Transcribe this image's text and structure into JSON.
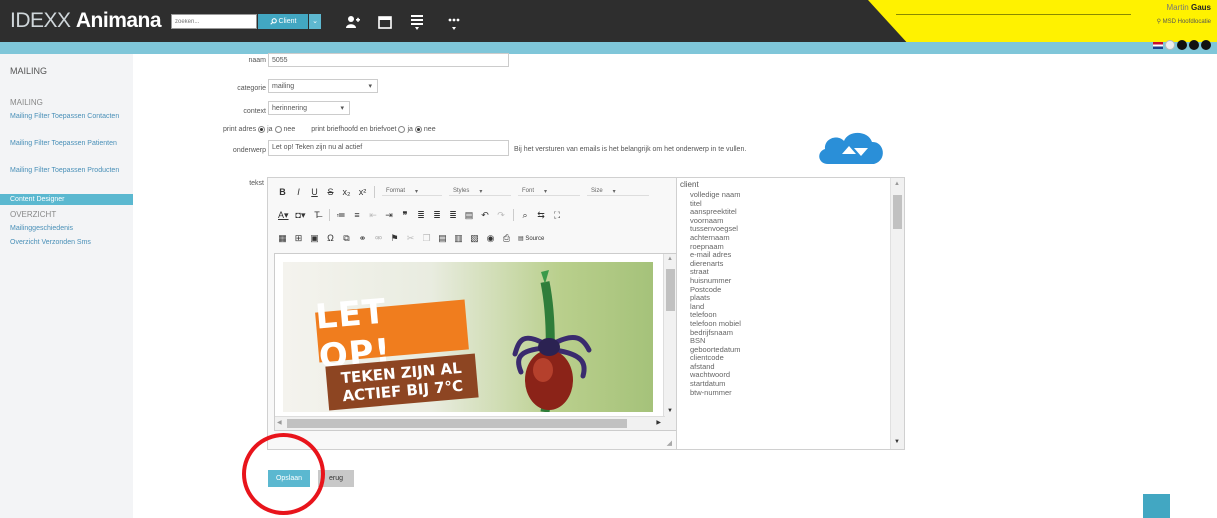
{
  "header": {
    "logo_light": "IDEXX",
    "logo_bold": "Animana",
    "search_placeholder": "zoeken...",
    "client_button": "Client",
    "user_first": "Martin",
    "user_last": "Gaus",
    "location": "MSD Hoofdlocatie"
  },
  "sidebar": {
    "title": "MAILING",
    "section_mailing": "MAILING",
    "item_contacten": "Mailing Filter Toepassen Contacten",
    "item_patienten": "Mailing Filter Toepassen Patienten",
    "item_producten": "Mailing Filter Toepassen Producten",
    "item_active": "Content Designer",
    "section_overzicht": "OVERZICHT",
    "item_history": "Mailinggeschiedenis",
    "item_sms": "Overzicht Verzonden Sms"
  },
  "form": {
    "naam_label": "naam",
    "naam_value": "5055",
    "categorie_label": "categorie",
    "categorie_value": "mailing",
    "context_label": "context",
    "context_value": "herinnering",
    "print_label": "print adres",
    "ja": "ja",
    "nee": "nee",
    "print_brief_label": "print briefhoofd en briefvoet",
    "onderwerp_label": "onderwerp",
    "onderwerp_value": "Let op! Teken zijn nu al actief",
    "onderwerp_hint": "Bij het versturen van emails is het belangrijk om het onderwerp in te vullen.",
    "tekst_label": "tekst"
  },
  "toolbar": {
    "format": "Format",
    "styles": "Styles",
    "font": "Font",
    "size": "Size",
    "source": "Source"
  },
  "banner": {
    "line1": "LET OP!",
    "line2": "TEKEN ZIJN AL",
    "line3": "ACTIEF BIJ 7°C"
  },
  "fieldlist": {
    "header": "client",
    "items": [
      "volledige naam",
      "titel",
      "aanspreektitel",
      "voornaam",
      "tussenvoegsel",
      "achternaam",
      "roepnaam",
      "e-mail adres",
      "dierenarts",
      "straat",
      "huisnummer",
      "Postcode",
      "plaats",
      "land",
      "telefoon",
      "telefoon mobiel",
      "bedrijfsnaam",
      "BSN",
      "geboortedatum",
      "clientcode",
      "afstand",
      "wachtwoord",
      "startdatum",
      "btw-nummer"
    ]
  },
  "actions": {
    "save": "Opslaan",
    "back": "erug"
  },
  "colors": {
    "topbar": "#2e2e2e",
    "accent": "#5bb8d0",
    "user_bar": "#fff200",
    "highlight_circle": "#e8141b"
  }
}
